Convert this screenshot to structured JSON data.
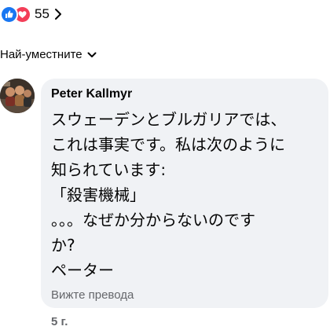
{
  "reactions": {
    "icons": [
      "like-icon",
      "love-icon"
    ],
    "count": "55",
    "like_color": "#1877f2",
    "love_color": "#f33e58"
  },
  "sort": {
    "label": "Най-уместните",
    "icon": "chevron-down-icon"
  },
  "comment": {
    "author": "Peter Kallmyr",
    "lines": [
      "スウェーデンとブルガリアでは、",
      "これは事実です。私は次のように",
      "知られています:",
      "「殺害機械」",
      "。。。なぜか分からないのです",
      "か?",
      "ペーター"
    ],
    "see_translation": "Вижте превода",
    "time": "5 г.",
    "bubble_color": "#f0f2f5"
  }
}
